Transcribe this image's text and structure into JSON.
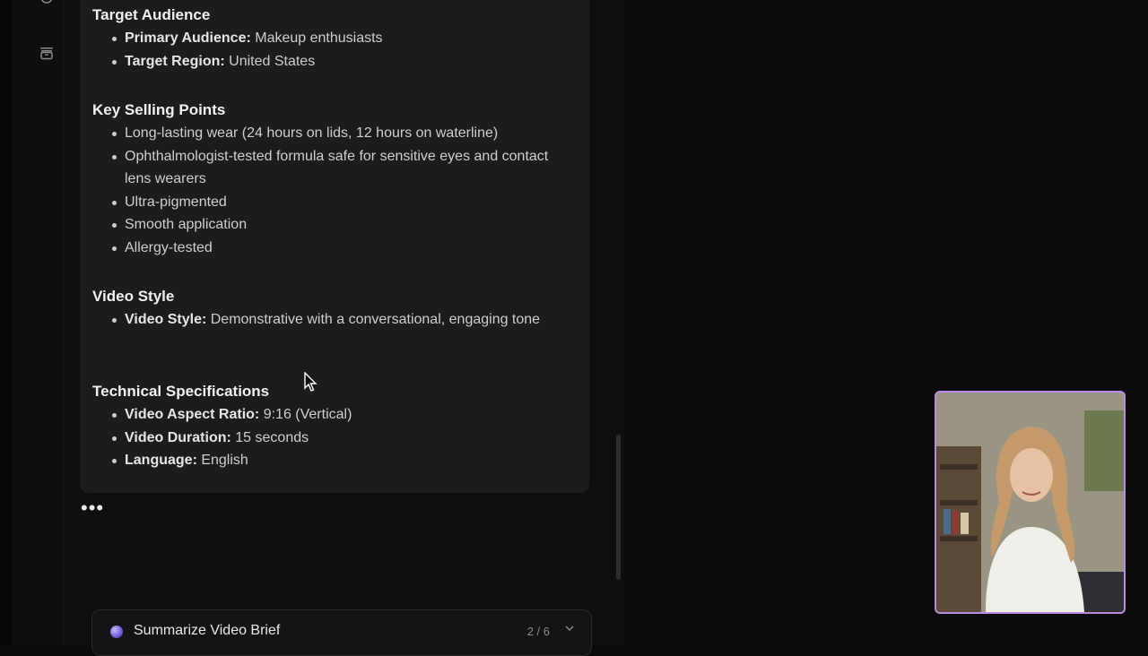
{
  "sections": [
    {
      "heading": "Target Audience",
      "items": [
        {
          "bold": "Primary Audience:",
          "text": " Makeup enthusiasts"
        },
        {
          "bold": "Target Region:",
          "text": " United States"
        }
      ]
    },
    {
      "heading": "Key Selling Points",
      "items": [
        {
          "bold": "",
          "text": "Long-lasting wear (24 hours on lids, 12 hours on waterline)"
        },
        {
          "bold": "",
          "text": "Ophthalmologist-tested formula safe for sensitive eyes and contact lens wearers"
        },
        {
          "bold": "",
          "text": "Ultra-pigmented"
        },
        {
          "bold": "",
          "text": "Smooth application"
        },
        {
          "bold": "",
          "text": "Allergy-tested"
        }
      ]
    },
    {
      "heading": "Video Style",
      "items": [
        {
          "bold": "Video Style:",
          "text": " Demonstrative with a conversational, engaging tone"
        }
      ]
    },
    {
      "heading": "Technical Specifications",
      "items": [
        {
          "bold": "Video Aspect Ratio:",
          "text": " 9:16 (Vertical)"
        },
        {
          "bold": "Video Duration:",
          "text": " 15 seconds"
        },
        {
          "bold": "Language:",
          "text": " English"
        }
      ]
    }
  ],
  "typing_indicator": "•••",
  "bottom_task": {
    "label": "Summarize Video Brief",
    "progress": "2 / 6"
  },
  "icons": {
    "rail_top": "circle-icon",
    "rail_archive": "archive-icon",
    "task_status": "ai-orb-icon",
    "task_expand": "chevron-down-icon",
    "pointer": "mouse-cursor-icon"
  },
  "colors": {
    "background": "#0b0b0c",
    "card": "#1c1c1e",
    "video_border": "#b98be0"
  }
}
